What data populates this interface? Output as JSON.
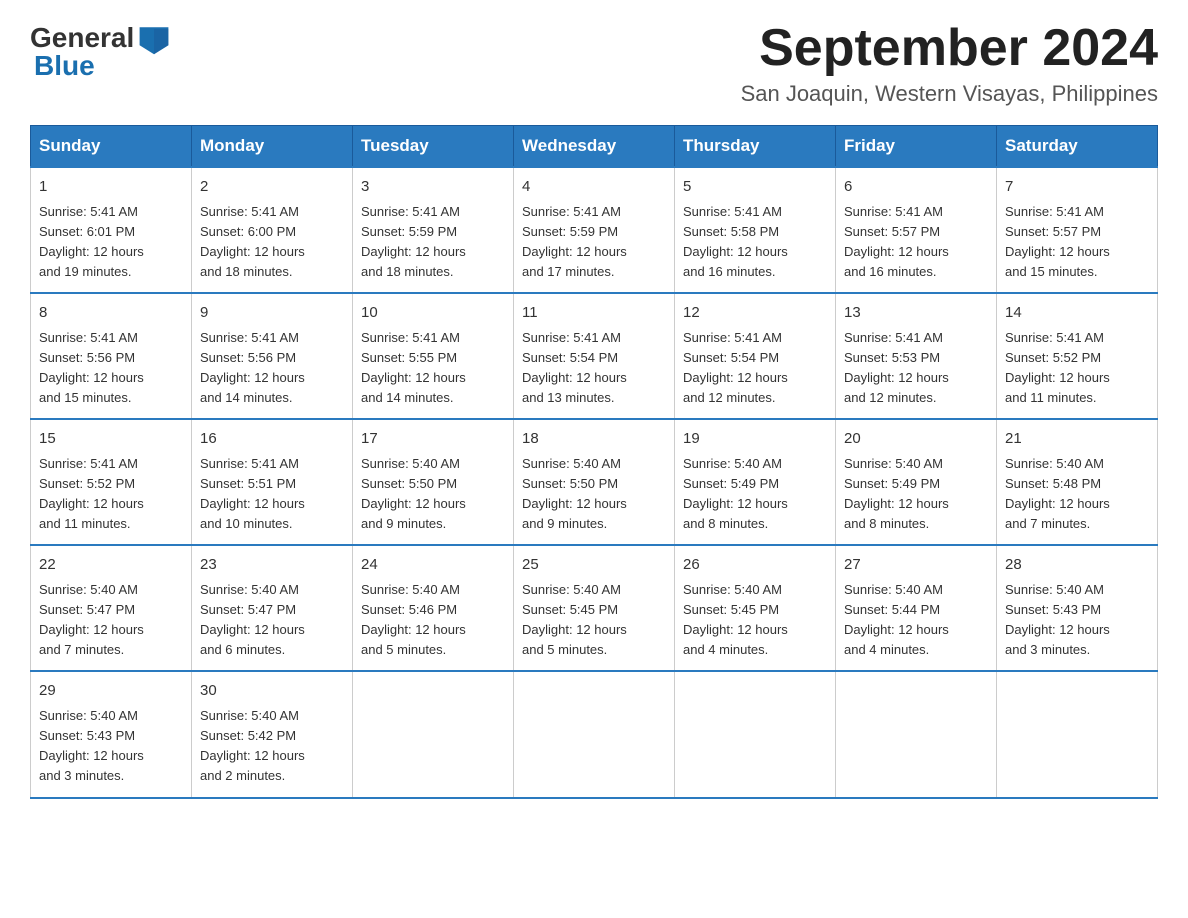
{
  "header": {
    "logo_general": "General",
    "logo_blue": "Blue",
    "month_title": "September 2024",
    "location": "San Joaquin, Western Visayas, Philippines"
  },
  "weekdays": [
    "Sunday",
    "Monday",
    "Tuesday",
    "Wednesday",
    "Thursday",
    "Friday",
    "Saturday"
  ],
  "weeks": [
    [
      {
        "day": "1",
        "sunrise": "5:41 AM",
        "sunset": "6:01 PM",
        "daylight": "12 hours and 19 minutes."
      },
      {
        "day": "2",
        "sunrise": "5:41 AM",
        "sunset": "6:00 PM",
        "daylight": "12 hours and 18 minutes."
      },
      {
        "day": "3",
        "sunrise": "5:41 AM",
        "sunset": "5:59 PM",
        "daylight": "12 hours and 18 minutes."
      },
      {
        "day": "4",
        "sunrise": "5:41 AM",
        "sunset": "5:59 PM",
        "daylight": "12 hours and 17 minutes."
      },
      {
        "day": "5",
        "sunrise": "5:41 AM",
        "sunset": "5:58 PM",
        "daylight": "12 hours and 16 minutes."
      },
      {
        "day": "6",
        "sunrise": "5:41 AM",
        "sunset": "5:57 PM",
        "daylight": "12 hours and 16 minutes."
      },
      {
        "day": "7",
        "sunrise": "5:41 AM",
        "sunset": "5:57 PM",
        "daylight": "12 hours and 15 minutes."
      }
    ],
    [
      {
        "day": "8",
        "sunrise": "5:41 AM",
        "sunset": "5:56 PM",
        "daylight": "12 hours and 15 minutes."
      },
      {
        "day": "9",
        "sunrise": "5:41 AM",
        "sunset": "5:56 PM",
        "daylight": "12 hours and 14 minutes."
      },
      {
        "day": "10",
        "sunrise": "5:41 AM",
        "sunset": "5:55 PM",
        "daylight": "12 hours and 14 minutes."
      },
      {
        "day": "11",
        "sunrise": "5:41 AM",
        "sunset": "5:54 PM",
        "daylight": "12 hours and 13 minutes."
      },
      {
        "day": "12",
        "sunrise": "5:41 AM",
        "sunset": "5:54 PM",
        "daylight": "12 hours and 12 minutes."
      },
      {
        "day": "13",
        "sunrise": "5:41 AM",
        "sunset": "5:53 PM",
        "daylight": "12 hours and 12 minutes."
      },
      {
        "day": "14",
        "sunrise": "5:41 AM",
        "sunset": "5:52 PM",
        "daylight": "12 hours and 11 minutes."
      }
    ],
    [
      {
        "day": "15",
        "sunrise": "5:41 AM",
        "sunset": "5:52 PM",
        "daylight": "12 hours and 11 minutes."
      },
      {
        "day": "16",
        "sunrise": "5:41 AM",
        "sunset": "5:51 PM",
        "daylight": "12 hours and 10 minutes."
      },
      {
        "day": "17",
        "sunrise": "5:40 AM",
        "sunset": "5:50 PM",
        "daylight": "12 hours and 9 minutes."
      },
      {
        "day": "18",
        "sunrise": "5:40 AM",
        "sunset": "5:50 PM",
        "daylight": "12 hours and 9 minutes."
      },
      {
        "day": "19",
        "sunrise": "5:40 AM",
        "sunset": "5:49 PM",
        "daylight": "12 hours and 8 minutes."
      },
      {
        "day": "20",
        "sunrise": "5:40 AM",
        "sunset": "5:49 PM",
        "daylight": "12 hours and 8 minutes."
      },
      {
        "day": "21",
        "sunrise": "5:40 AM",
        "sunset": "5:48 PM",
        "daylight": "12 hours and 7 minutes."
      }
    ],
    [
      {
        "day": "22",
        "sunrise": "5:40 AM",
        "sunset": "5:47 PM",
        "daylight": "12 hours and 7 minutes."
      },
      {
        "day": "23",
        "sunrise": "5:40 AM",
        "sunset": "5:47 PM",
        "daylight": "12 hours and 6 minutes."
      },
      {
        "day": "24",
        "sunrise": "5:40 AM",
        "sunset": "5:46 PM",
        "daylight": "12 hours and 5 minutes."
      },
      {
        "day": "25",
        "sunrise": "5:40 AM",
        "sunset": "5:45 PM",
        "daylight": "12 hours and 5 minutes."
      },
      {
        "day": "26",
        "sunrise": "5:40 AM",
        "sunset": "5:45 PM",
        "daylight": "12 hours and 4 minutes."
      },
      {
        "day": "27",
        "sunrise": "5:40 AM",
        "sunset": "5:44 PM",
        "daylight": "12 hours and 4 minutes."
      },
      {
        "day": "28",
        "sunrise": "5:40 AM",
        "sunset": "5:43 PM",
        "daylight": "12 hours and 3 minutes."
      }
    ],
    [
      {
        "day": "29",
        "sunrise": "5:40 AM",
        "sunset": "5:43 PM",
        "daylight": "12 hours and 3 minutes."
      },
      {
        "day": "30",
        "sunrise": "5:40 AM",
        "sunset": "5:42 PM",
        "daylight": "12 hours and 2 minutes."
      },
      null,
      null,
      null,
      null,
      null
    ]
  ]
}
